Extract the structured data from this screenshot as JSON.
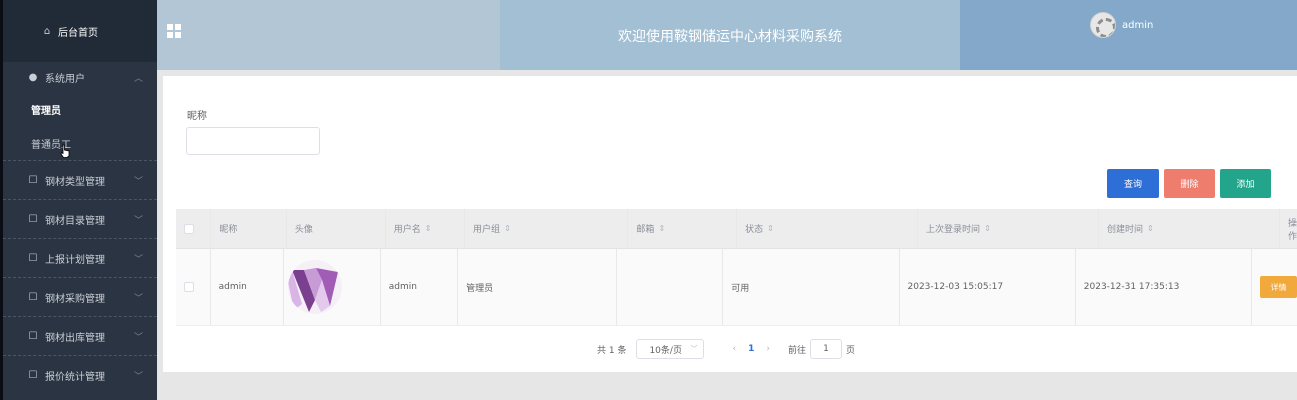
{
  "sidebar": {
    "home": "后台首页",
    "group_system": "系统用户",
    "sub_admin": "管理员",
    "sub_staff": "普通员工",
    "items": [
      {
        "label": "钢材类型管理"
      },
      {
        "label": "钢材目录管理"
      },
      {
        "label": "上报计划管理"
      },
      {
        "label": "钢材采购管理"
      },
      {
        "label": "钢材出库管理"
      },
      {
        "label": "报价统计管理"
      }
    ]
  },
  "header": {
    "title": "欢迎使用鞍钢储运中心材料采购系统",
    "username": "admin"
  },
  "search": {
    "label": "昵称",
    "value": "",
    "placeholder": ""
  },
  "actions": {
    "query": "查询",
    "delete": "删除",
    "add": "添加"
  },
  "table": {
    "columns": [
      "昵称",
      "头像",
      "用户名",
      "用户组",
      "邮箱",
      "状态",
      "上次登录时间",
      "创建时间",
      "操作"
    ],
    "rows": [
      {
        "nickname": "admin",
        "username": "admin",
        "group": "管理员",
        "email": "",
        "status": "可用",
        "last_login": "2023-12-03 15:05:17",
        "created": "2023-12-31 17:35:13",
        "action": "详情"
      }
    ]
  },
  "pagination": {
    "total": "共 1 条",
    "page_size": "10条/页",
    "current": "1",
    "goto_label": "前往",
    "goto_value": "1",
    "page_suffix": "页"
  }
}
